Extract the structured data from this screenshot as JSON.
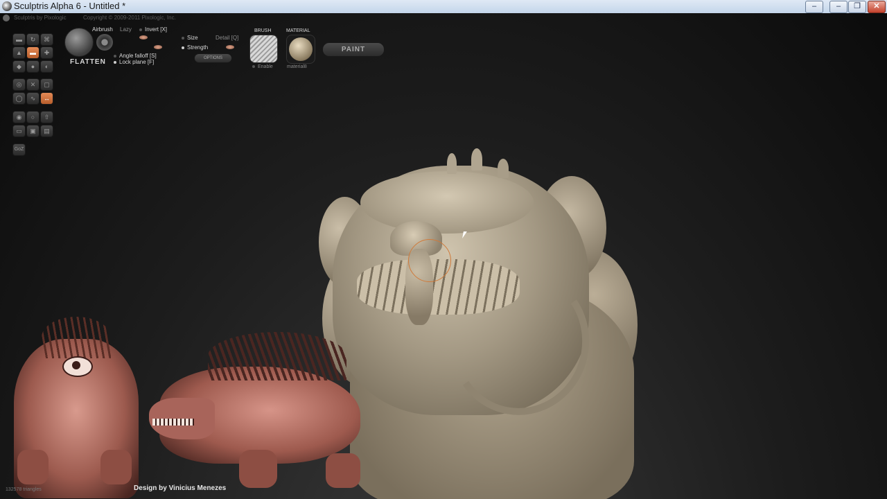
{
  "window": {
    "title": "Sculptris Alpha 6 - Untitled *",
    "controls": {
      "minimize": "–",
      "restore_small": "–",
      "maximize": "❐",
      "close": "✕"
    }
  },
  "app_header": {
    "product": "Sculptris by Pixologic",
    "copyright": "Copyright © 2009-2011 Pixologic, Inc."
  },
  "toolbar": {
    "tool_name": "FLATTEN",
    "airbrush_label": "Airbrush",
    "lazy_label": "Lazy",
    "invert_label": "Invert [X]",
    "size_label": "Size",
    "detail_label": "Detail [Q]",
    "strength_label": "Strength",
    "angle_falloff_label": "Angle falloff [S]",
    "lock_plane_label": "Lock plane [F]",
    "options_label": "OPTIONS",
    "brush_heading": "BRUSH",
    "enable_label": "Enable",
    "material_heading": "MATERIAL",
    "material_name": "material8",
    "paint_label": "PAINT"
  },
  "tool_palette": {
    "buttons": [
      {
        "name": "draw-tool-icon",
        "glyph": "▬",
        "active": false
      },
      {
        "name": "rotate-tool-icon",
        "glyph": "↻",
        "active": false
      },
      {
        "name": "crop-tool-icon",
        "glyph": "⌘",
        "active": false
      },
      {
        "name": "inflate-tool-icon",
        "glyph": "▲",
        "active": false
      },
      {
        "name": "flatten-tool-icon",
        "glyph": "▬",
        "active": true
      },
      {
        "name": "grab-tool-icon",
        "glyph": "✚",
        "active": false
      },
      {
        "name": "pinch-tool-icon",
        "glyph": "◆",
        "active": false
      },
      {
        "name": "smooth-tool-icon",
        "glyph": "●",
        "active": false
      },
      {
        "name": "crease-tool-icon",
        "glyph": "◐",
        "active": false
      },
      {
        "name": "reduce-tool-icon",
        "glyph": "◎",
        "active": false
      },
      {
        "name": "mask-tool-icon",
        "glyph": "✕",
        "active": false
      },
      {
        "name": "scale-tool-icon",
        "glyph": "▢",
        "active": false
      },
      {
        "name": "wireframe-tool-icon",
        "glyph": "◯",
        "active": false
      },
      {
        "name": "symmetry-wave-icon",
        "glyph": "∿",
        "active": false
      },
      {
        "name": "symmetry-toggle-icon",
        "glyph": "↔",
        "active": true
      },
      {
        "name": "subdivide-icon",
        "glyph": "◉",
        "active": false
      },
      {
        "name": "new-sphere-icon",
        "glyph": "○",
        "active": false
      },
      {
        "name": "import-icon",
        "glyph": "⇧",
        "active": false
      },
      {
        "name": "plane-icon",
        "glyph": "▭",
        "active": false
      },
      {
        "name": "save-icon",
        "glyph": "▣",
        "active": false
      },
      {
        "name": "open-icon",
        "glyph": "▤",
        "active": false
      },
      {
        "name": "goz-icon",
        "glyph": "GoZ",
        "active": false
      }
    ]
  },
  "scene": {
    "footer": "Design by Vinicius Menezes",
    "triangle_count": "132578 triangles"
  },
  "colors": {
    "accent": "#d9773f",
    "clay": "#a39883",
    "reference": "#b9736a"
  }
}
